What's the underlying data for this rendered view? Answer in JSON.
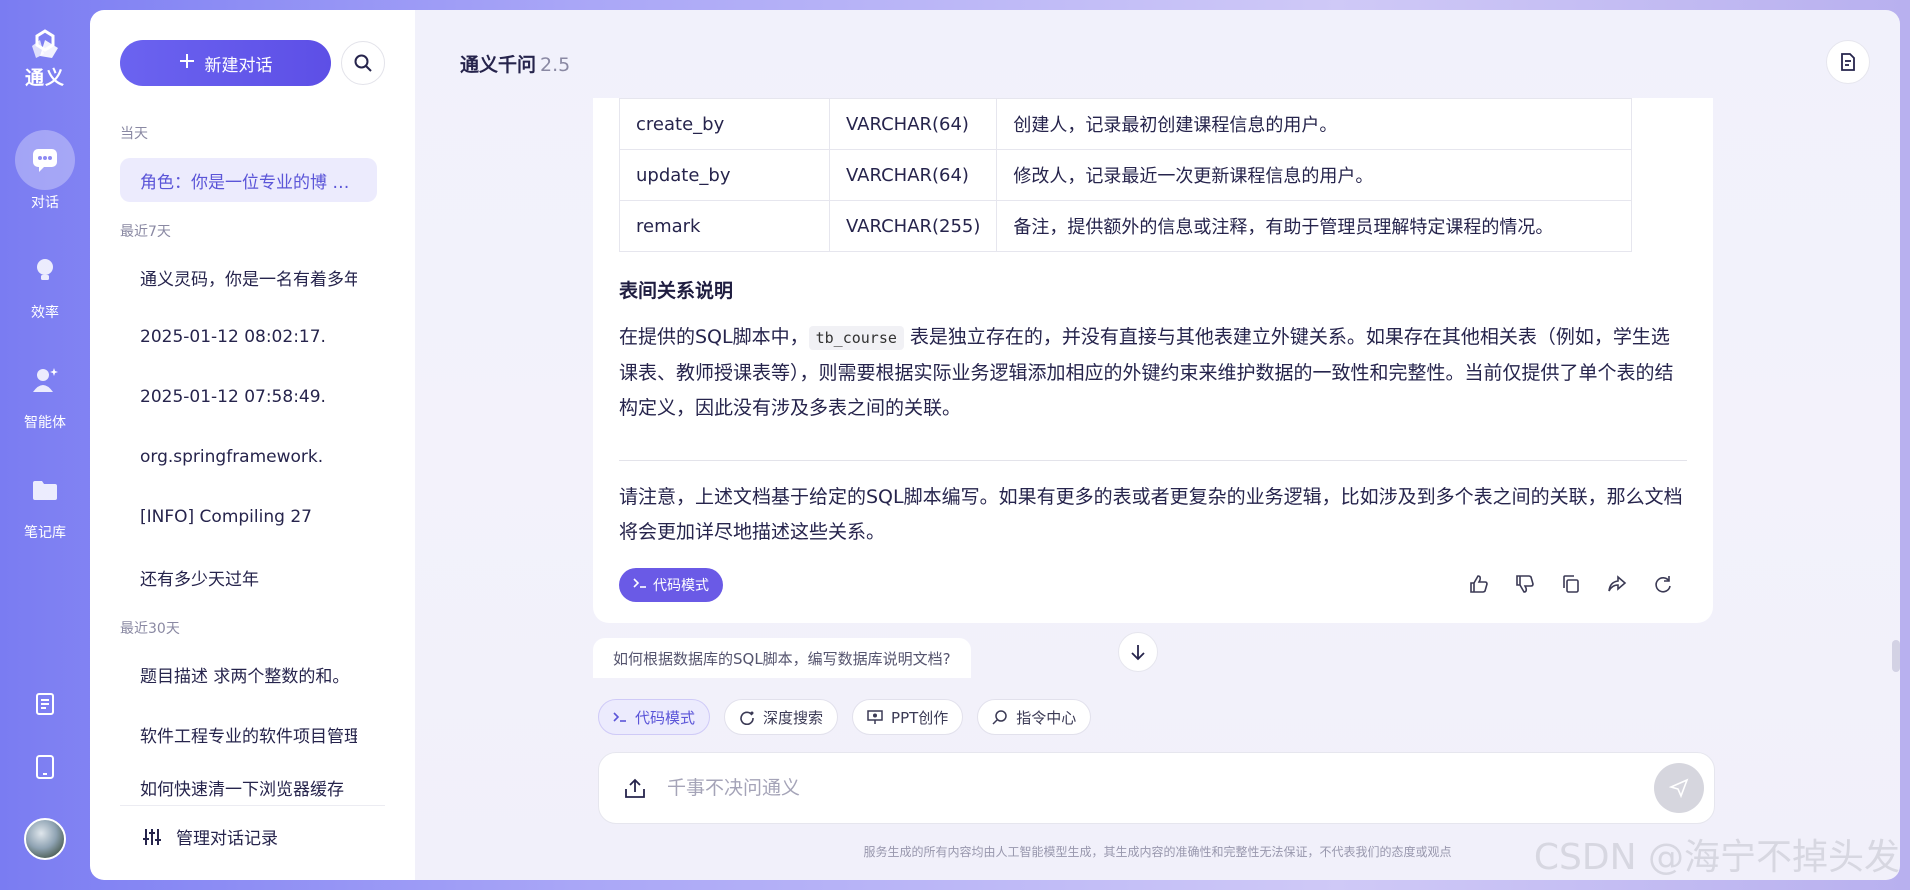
{
  "brand": {
    "name": "通义"
  },
  "rail": {
    "items": [
      {
        "label": "对话",
        "icon": "chat-icon"
      },
      {
        "label": "效率",
        "icon": "lightbulb-icon"
      },
      {
        "label": "智能体",
        "icon": "agent-icon"
      },
      {
        "label": "笔记库",
        "icon": "folder-icon"
      }
    ]
  },
  "sidebar": {
    "new_chat": "新建对话",
    "groups": [
      {
        "title": "当天",
        "items": [
          "角色：你是一位专业的博 …"
        ]
      },
      {
        "title": "最近7天",
        "items": [
          "通义灵码，你是一名有着多年",
          "2025-01-12 08:02:17.",
          "2025-01-12 07:58:49.",
          "org.springframework.",
          "[INFO] Compiling 27",
          "还有多少天过年"
        ]
      },
      {
        "title": "最近30天",
        "items": [
          "题目描述 求两个整数的和。",
          "软件工程专业的软件项目管理",
          "如何快速清一下浏览器缓存"
        ]
      }
    ],
    "manage": "管理对话记录"
  },
  "header": {
    "title": "通义千问",
    "version": "2.5"
  },
  "answer": {
    "table_rows": [
      [
        "create_by",
        "VARCHAR(64)",
        "创建人，记录最初创建课程信息的用户。"
      ],
      [
        "update_by",
        "VARCHAR(64)",
        "修改人，记录最近一次更新课程信息的用户。"
      ],
      [
        "remark",
        "VARCHAR(255)",
        "备注，提供额外的信息或注释，有助于管理员理解特定课程的情况。"
      ]
    ],
    "section_title": "表间关系说明",
    "para1_before": "在提供的SQL脚本中，",
    "para1_code": "tb_course",
    "para1_after": " 表是独立存在的，并没有直接与其他表建立外键关系。如果存在其他相关表（例如，学生选课表、教师授课表等），则需要根据实际业务逻辑添加相应的外键约束来维护数据的一致性和完整性。当前仅提供了单个表的结构定义，因此没有涉及多表之间的关联。",
    "para2": "请注意，上述文档基于给定的SQL脚本编写。如果有更多的表或者更复杂的业务逻辑，比如涉及到多个表之间的关联，那么文档将会更加详尽地描述这些关系。",
    "code_mode": "代码模式"
  },
  "suggestion": "如何根据数据库的SQL脚本，编写数据库说明文档?",
  "chips": [
    "代码模式",
    "深度搜索",
    "PPT创作",
    "指令中心"
  ],
  "input": {
    "placeholder": "千事不决问通义"
  },
  "disclaimer": "服务生成的所有内容均由人工智能模型生成，其生成内容的准确性和完整性无法保证，不代表我们的态度或观点",
  "watermark": "CSDN @海宁不掉头发",
  "colors": {
    "accent": "#5d4fe6",
    "rail_gradient_start": "#7a7cf2",
    "active_bg": "#ecebfd"
  }
}
